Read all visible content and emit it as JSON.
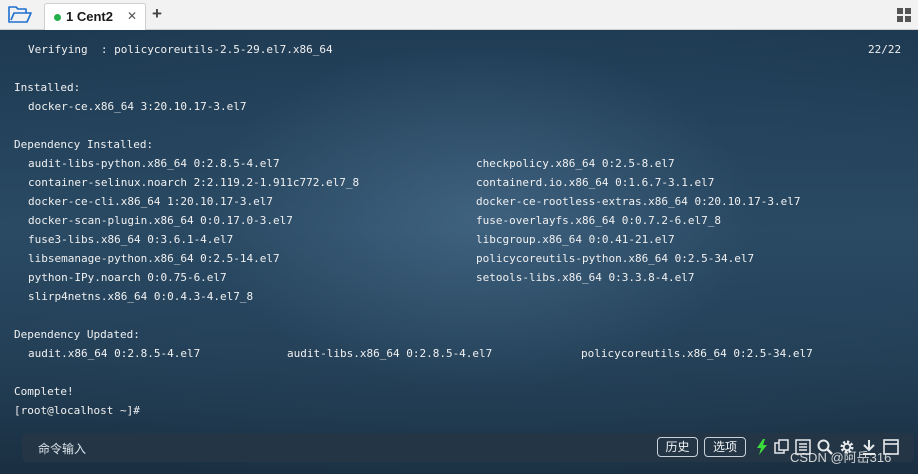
{
  "tabbar": {
    "folder_icon": "folder-open-icon",
    "tab": {
      "title": "1 Cent2",
      "status_color": "#22b14c",
      "close_glyph": "✕"
    },
    "add_glyph": "+",
    "layout_icon": "grid-icon"
  },
  "terminal": {
    "verify": {
      "text": "Verifying  : policycoreutils-2.5-29.el7.x86_64",
      "count": "22/22"
    },
    "installed_header": "Installed:",
    "installed_items": [
      "docker-ce.x86_64 3:20.10.17-3.el7"
    ],
    "dep_installed_header": "Dependency Installed:",
    "dep_installed_left": [
      "audit-libs-python.x86_64 0:2.8.5-4.el7",
      "container-selinux.noarch 2:2.119.2-1.911c772.el7_8",
      "docker-ce-cli.x86_64 1:20.10.17-3.el7",
      "docker-scan-plugin.x86_64 0:0.17.0-3.el7",
      "fuse3-libs.x86_64 0:3.6.1-4.el7",
      "libsemanage-python.x86_64 0:2.5-14.el7",
      "python-IPy.noarch 0:0.75-6.el7",
      "slirp4netns.x86_64 0:0.4.3-4.el7_8"
    ],
    "dep_installed_right": [
      "checkpolicy.x86_64 0:2.5-8.el7",
      "containerd.io.x86_64 0:1.6.7-3.1.el7",
      "docker-ce-rootless-extras.x86_64 0:20.10.17-3.el7",
      "fuse-overlayfs.x86_64 0:0.7.2-6.el7_8",
      "libcgroup.x86_64 0:0.41-21.el7",
      "policycoreutils-python.x86_64 0:2.5-34.el7",
      "setools-libs.x86_64 0:3.3.8-4.el7"
    ],
    "dep_updated_header": "Dependency Updated:",
    "dep_updated_items": [
      "audit.x86_64 0:2.8.5-4.el7",
      "audit-libs.x86_64 0:2.8.5-4.el7",
      "policycoreutils.x86_64 0:2.5-34.el7"
    ],
    "complete": "Complete!",
    "prompt": "[root@localhost ~]#"
  },
  "cmdbar": {
    "label": "命令输入",
    "history_button": "历史",
    "options_button": "选项",
    "icons": [
      "lightning-icon",
      "copy-icon",
      "list-icon",
      "search-icon",
      "gear-icon",
      "download-icon",
      "window-icon"
    ],
    "accent_color": "#3ddc3d"
  },
  "watermark": "CSDN @阿岳316"
}
